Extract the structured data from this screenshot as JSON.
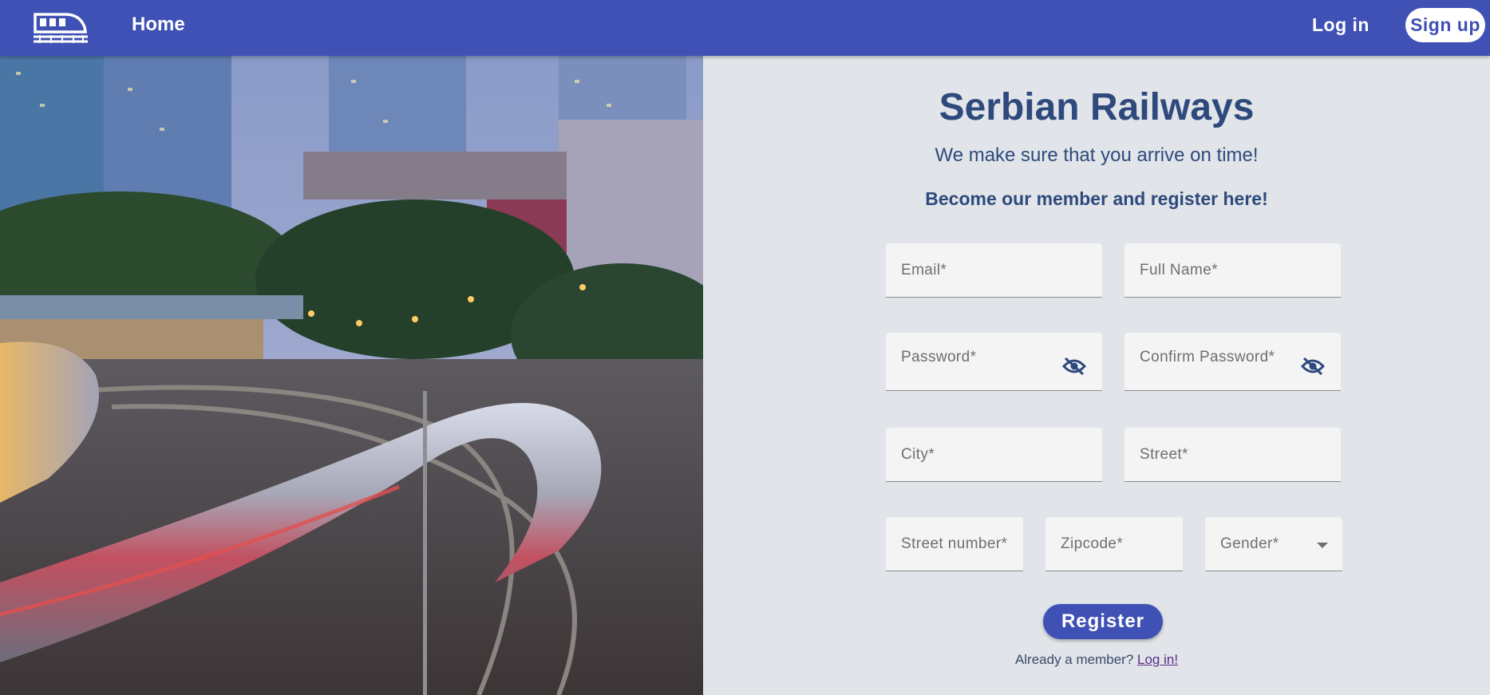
{
  "nav": {
    "home_label": "Home",
    "login_label": "Log in",
    "signup_label": "Sign up"
  },
  "hero": {
    "title": "Serbian Railways",
    "subtitle": "We make sure that you arrive on time!",
    "cta": "Become our member and register here!"
  },
  "form": {
    "email_label": "Email*",
    "fullname_label": "Full Name*",
    "password_label": "Password*",
    "confirm_password_label": "Confirm Password*",
    "city_label": "City*",
    "street_label": "Street*",
    "street_number_label": "Street number*",
    "zipcode_label": "Zipcode*",
    "gender_label": "Gender*",
    "register_label": "Register",
    "already_text": "Already a member?",
    "login_link": "Log in!"
  },
  "colors": {
    "primary": "#3f51b5",
    "heading": "#2e4a7d",
    "panel_bg": "#e1e4e8",
    "field_bg": "#f4f4f4"
  },
  "icons": [
    "train-icon",
    "eye-off-icon",
    "chevron-down-icon"
  ]
}
